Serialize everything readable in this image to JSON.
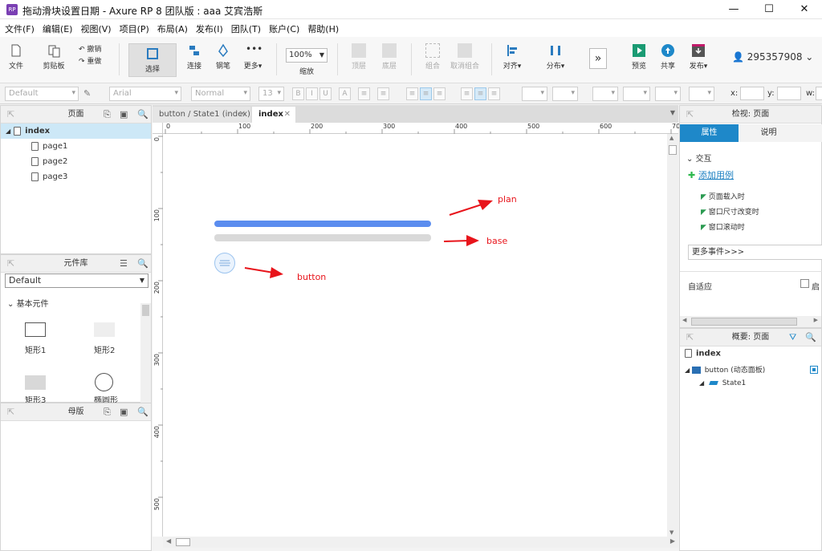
{
  "titlebar": {
    "title": "拖动滑块设置日期 - Axure RP 8 团队版 : aaa    艾宾浩斯",
    "min": "—",
    "max": "☐",
    "close": "✕"
  },
  "menu": [
    "文件(F)",
    "编辑(E)",
    "视图(V)",
    "项目(P)",
    "布局(A)",
    "发布(I)",
    "团队(T)",
    "账户(C)",
    "帮助(H)"
  ],
  "toolbar": {
    "file": "文件",
    "clipboard": "剪贴板",
    "undo": "撤销",
    "redo": "重做",
    "select": "选择",
    "connect": "连接",
    "pen": "钢笔",
    "more": "更多▾",
    "zoom_value": "100%",
    "zoom_label": "缩放",
    "top": "顶层",
    "bottom": "底层",
    "group": "组合",
    "ungroup": "取消组合",
    "align": "对齐▾",
    "distribute": "分布▾",
    "preview": "预览",
    "share": "共享",
    "publish": "发布▾",
    "user": "295357908"
  },
  "format": {
    "style": "Default",
    "font": "Arial",
    "weight": "Normal",
    "size": "13",
    "x_label": "x:",
    "y_label": "y:",
    "w_label": "w:"
  },
  "pages_panel": {
    "title": "页面",
    "root": "index",
    "pages": [
      "page1",
      "page2",
      "page3"
    ]
  },
  "library_panel": {
    "title": "元件库",
    "selected": "Default",
    "section": "基本元件",
    "items": [
      "矩形1",
      "矩形2",
      "矩形3",
      "椭圆形"
    ]
  },
  "masters_panel": {
    "title": "母版"
  },
  "tabs": [
    {
      "label": "button / State1 (index)"
    },
    {
      "label": "index"
    }
  ],
  "ruler_h": [
    "0",
    "100",
    "200",
    "300",
    "400",
    "500",
    "600",
    "70"
  ],
  "ruler_v": [
    "0",
    "100",
    "200",
    "300",
    "400",
    "500"
  ],
  "canvas": {
    "plan_label": "plan",
    "base_label": "base",
    "button_label": "button"
  },
  "inspect": {
    "title": "检视: 页面",
    "tab_props": "属性",
    "tab_notes": "说明",
    "interaction": "交互",
    "add_case": "添加用例",
    "events": [
      "页面载入时",
      "窗口尺寸改变时",
      "窗口滚动时"
    ],
    "more_events": "更多事件>>>",
    "adaptive": "自适应",
    "adaptive_check": "启"
  },
  "outline": {
    "title": "概要: 页面",
    "root": "index",
    "panel": "button (动态面板)",
    "state": "State1"
  },
  "colors": {
    "accent": "#1e88c9",
    "slider_plan": "#5b8def",
    "slider_base": "#d9d9d9",
    "arrow": "#e8141b"
  }
}
